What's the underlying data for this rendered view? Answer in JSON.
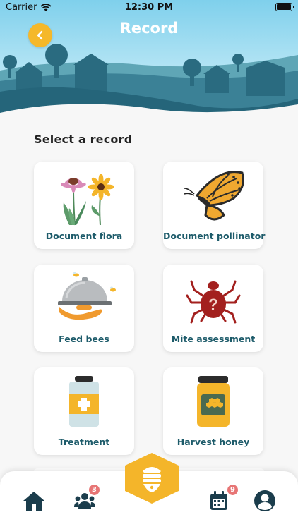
{
  "status_bar": {
    "carrier": "Carrier",
    "time": "12:30 PM"
  },
  "header": {
    "title": "Record"
  },
  "section_title": "Select a record",
  "cards": [
    {
      "label": "Document flora",
      "icon": "flowers-icon"
    },
    {
      "label": "Document pollinator",
      "icon": "butterfly-icon"
    },
    {
      "label": "Feed bees",
      "icon": "feeding-tray-icon"
    },
    {
      "label": "Mite assessment",
      "icon": "mite-icon"
    },
    {
      "label": "Treatment",
      "icon": "treatment-jar-icon"
    },
    {
      "label": "Harvest honey",
      "icon": "honey-jar-icon"
    }
  ],
  "bottom_nav": {
    "items": [
      {
        "icon": "home-icon"
      },
      {
        "icon": "team-icon",
        "badge": "3"
      },
      {
        "icon": "hive-icon"
      },
      {
        "icon": "calendar-icon",
        "badge": "9"
      },
      {
        "icon": "profile-icon"
      }
    ]
  },
  "colors": {
    "accent": "#f5b82a",
    "teal": "#1d5b6a",
    "badge": "#e77575"
  }
}
